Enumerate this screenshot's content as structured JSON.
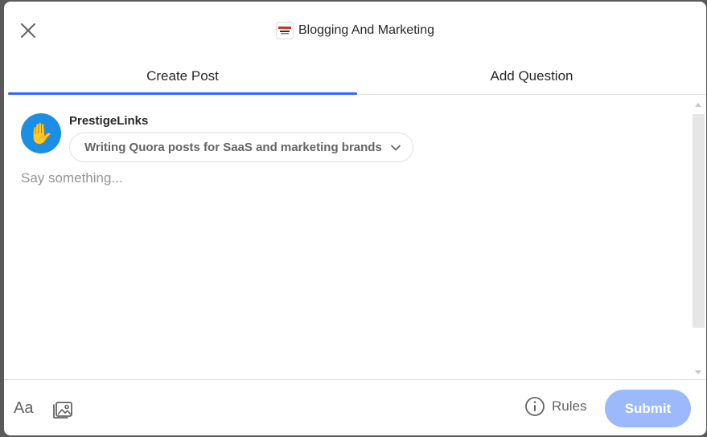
{
  "space": {
    "name": "Blogging And Marketing",
    "logo_icon": "space-logo-icon"
  },
  "tabs": [
    {
      "label": "Create Post",
      "active": true
    },
    {
      "label": "Add Question",
      "active": false
    }
  ],
  "author": {
    "name": "PrestigeLinks",
    "avatar_icon": "raised-hand-icon"
  },
  "audience": {
    "selected": "Writing Quora posts for SaaS and marketing brands"
  },
  "editor": {
    "placeholder": "Say something...",
    "value": ""
  },
  "footer": {
    "font_label": "Aa",
    "rules_label": "Rules",
    "submit_label": "Submit"
  },
  "colors": {
    "accent": "#2e69ff",
    "submit_disabled": "#9bb9fb",
    "avatar_bg": "#1b8fe6"
  }
}
